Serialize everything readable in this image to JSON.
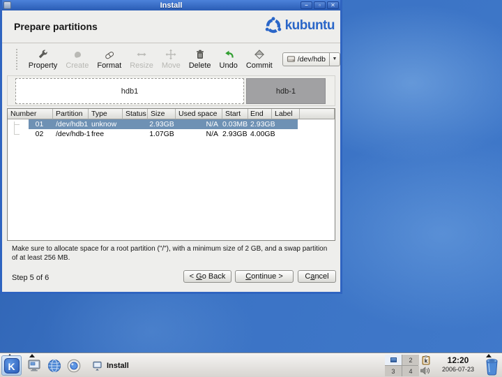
{
  "window": {
    "title": "Install",
    "heading": "Prepare partitions",
    "logo_text": "kubuntu",
    "controls": {
      "minimize": "–",
      "maximize": "▫",
      "close": "✕"
    }
  },
  "colors": {
    "titlebar_blue": "#2e5fbe",
    "selection_blue": "#6e91b4",
    "kubuntu_blue": "#2a66c8",
    "desktop_blue": "#3a72c4",
    "segment_gray": "#a1a1a3"
  },
  "toolbar": {
    "buttons": [
      {
        "label": "Property",
        "icon": "wrench",
        "enabled": true
      },
      {
        "label": "Create",
        "icon": "create",
        "enabled": false
      },
      {
        "label": "Format",
        "icon": "eraser",
        "enabled": true
      },
      {
        "label": "Resize",
        "icon": "resize-arrows",
        "enabled": false
      },
      {
        "label": "Move",
        "icon": "move-arrows",
        "enabled": false
      },
      {
        "label": "Delete",
        "icon": "trash",
        "enabled": true
      },
      {
        "label": "Undo",
        "icon": "undo-arrow",
        "enabled": true
      },
      {
        "label": "Commit",
        "icon": "commit-diamond",
        "enabled": true
      }
    ],
    "device_selector": {
      "value": "/dev/hdb",
      "arrow": "▼"
    }
  },
  "partition_bar": {
    "segments": [
      {
        "label": "hdb1",
        "selected": true
      },
      {
        "label": "hdb-1",
        "selected": false
      }
    ]
  },
  "table": {
    "columns": [
      "Number",
      "Partition",
      "Type",
      "Status",
      "Size",
      "Used space",
      "Start",
      "End",
      "Label"
    ],
    "rows": [
      {
        "selected": true,
        "cells": [
          "01",
          "/dev/hdb1",
          "unknow",
          "",
          "2.93GB",
          "N/A",
          "0.03MB",
          "2.93GB",
          ""
        ]
      },
      {
        "selected": false,
        "cells": [
          "02",
          "/dev/hdb-1",
          "free",
          "",
          "1.07GB",
          "N/A",
          "2.93GB",
          "4.00GB",
          ""
        ]
      }
    ]
  },
  "note": "Make sure to allocate space for a root partition (\"/\"), with a minimum size of 2 GB, and a swap partition of at least 256 MB.",
  "footer": {
    "step": "Step 5 of 6",
    "back": {
      "pre": "< ",
      "accel": "G",
      "post": "o Back"
    },
    "continue": {
      "pre": "",
      "accel": "C",
      "post": "ontinue >"
    },
    "cancel": {
      "pre": "C",
      "accel": "a",
      "post": "ncel"
    }
  },
  "taskbar": {
    "task_label": "Install",
    "pager": {
      "cells": [
        "",
        "2",
        "3",
        "4"
      ]
    },
    "clock": {
      "time": "12:20",
      "date": "2006-07-23"
    }
  }
}
